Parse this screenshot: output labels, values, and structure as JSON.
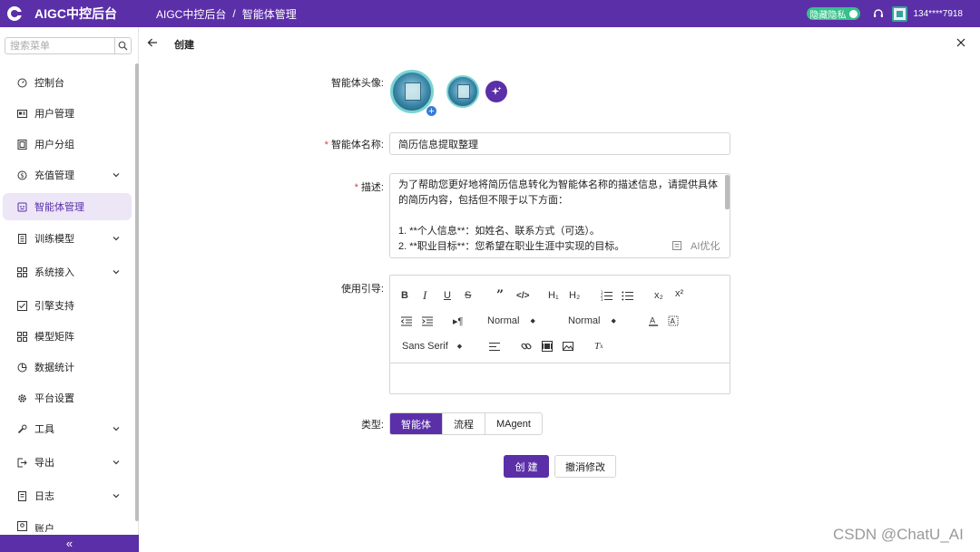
{
  "header": {
    "app_title": "AIGC中控后台",
    "breadcrumb": [
      "AIGC中控后台",
      "智能体管理"
    ],
    "breadcrumb_sep": "/",
    "privacy_toggle": "隐藏隐私",
    "user_phone": "134****7918",
    "brand_color": "#5b2fa8"
  },
  "sidebar": {
    "search_placeholder": "搜索菜单",
    "items": [
      {
        "label": "控制台",
        "icon": "dashboard-icon"
      },
      {
        "label": "用户管理",
        "icon": "id-card-icon"
      },
      {
        "label": "用户分组",
        "icon": "group-icon"
      },
      {
        "label": "充值管理",
        "icon": "coin-icon",
        "expandable": true
      },
      {
        "label": "智能体管理",
        "icon": "robot-icon",
        "active": true
      },
      {
        "label": "训练模型",
        "icon": "book-icon",
        "expandable": true
      },
      {
        "label": "系统接入",
        "icon": "grid-icon",
        "expandable": true
      },
      {
        "label": "引擎支持",
        "icon": "check-square-icon"
      },
      {
        "label": "模型矩阵",
        "icon": "matrix-icon"
      },
      {
        "label": "数据统计",
        "icon": "pie-chart-icon"
      },
      {
        "label": "平台设置",
        "icon": "gear-icon"
      },
      {
        "label": "工具",
        "icon": "wrench-icon",
        "expandable": true
      },
      {
        "label": "导出",
        "icon": "export-icon",
        "expandable": true
      },
      {
        "label": "日志",
        "icon": "log-icon",
        "expandable": true
      },
      {
        "label": "账户",
        "icon": "account-icon"
      }
    ],
    "collapse_glyph": "«"
  },
  "page": {
    "title": "创建",
    "avatar_label": "智能体头像:",
    "name_label": "智能体名称:",
    "name_value": "简历信息提取整理",
    "desc_label": "描述:",
    "desc_value": "为了帮助您更好地将简历信息转化为智能体名称的描述信息，请提供具体的简历内容，包括但不限于以下方面：\n\n1. **个人信息**：如姓名、联系方式（可选）。\n2. **职业目标**：您希望在职业生涯中实现的目标。",
    "ai_optimize": "AI优化",
    "guide_label": "使用引导:",
    "toolbar": {
      "header_select_1": "Normal",
      "header_select_2": "Normal",
      "font_select": "Sans Serif",
      "h1": "H₁",
      "h2": "H₂",
      "sub": "x₂",
      "sup": "x²"
    },
    "type_label": "类型:",
    "type_options": [
      "智能体",
      "流程",
      "MAgent"
    ],
    "type_selected": "智能体",
    "create_button": "创 建",
    "undo_button": "撤消修改"
  },
  "watermark": "CSDN @ChatU_AI"
}
